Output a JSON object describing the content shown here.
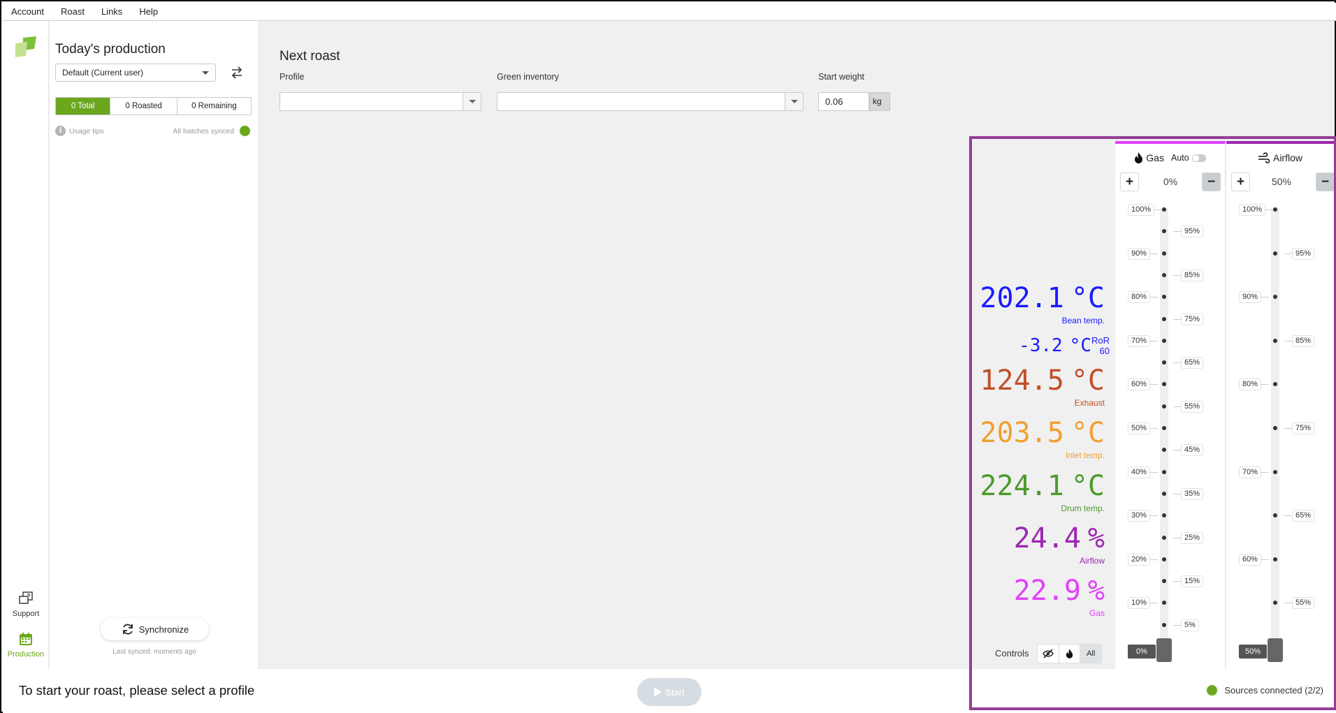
{
  "menu": [
    "Account",
    "Roast",
    "Links",
    "Help"
  ],
  "rail": {
    "support_label": "Support",
    "production_label": "Production"
  },
  "side": {
    "title": "Today's production",
    "user_select": "Default (Current user)",
    "tabs": [
      "0 Total",
      "0 Roasted",
      "0 Remaining"
    ],
    "usage_tips": "Usage tips",
    "batches_status": "All batches synced",
    "sync_button": "Synchronize",
    "last_synced": "Last synced: moments ago"
  },
  "main": {
    "title": "Next roast",
    "profile_label": "Profile",
    "profile_value": "",
    "inventory_label": "Green inventory",
    "inventory_value": "",
    "weight_label": "Start weight",
    "weight_value": "0.06",
    "weight_unit": "kg"
  },
  "footer": {
    "message": "To start your roast, please select a profile",
    "start_button": "Start",
    "sources": "Sources connected (2/2)"
  },
  "readings": [
    {
      "id": "bean",
      "value": "202.1",
      "unit": "°C",
      "label": "Bean temp.",
      "color": "#1a1aff"
    },
    {
      "id": "ror",
      "value": "-3.2",
      "unit": "°C",
      "label": "RoR 60",
      "color": "#1a1aff"
    },
    {
      "id": "exhaust",
      "value": "124.5",
      "unit": "°C",
      "label": "Exhaust",
      "color": "#c0502a"
    },
    {
      "id": "inlet",
      "value": "203.5",
      "unit": "°C",
      "label": "Inlet temp.",
      "color": "#f0a030"
    },
    {
      "id": "drum",
      "value": "224.1",
      "unit": "°C",
      "label": "Drum temp.",
      "color": "#4c9a2a"
    },
    {
      "id": "airflow",
      "value": "24.4",
      "unit": "%",
      "label": "Airflow",
      "color": "#9c27b0"
    },
    {
      "id": "gas",
      "value": "22.9",
      "unit": "%",
      "label": "Gas",
      "color": "#e040fb"
    }
  ],
  "ror_sub": [
    "RoR",
    "60"
  ],
  "controls": {
    "label": "Controls",
    "all_label": "All"
  },
  "gas": {
    "title": "Gas",
    "auto_label": "Auto",
    "value": "0%",
    "current": "0%",
    "level": 0,
    "ticks_left": [
      "100%",
      "90%",
      "80%",
      "70%",
      "60%",
      "50%",
      "40%",
      "30%",
      "20%",
      "10%"
    ],
    "ticks_right": [
      "95%",
      "85%",
      "75%",
      "65%",
      "55%",
      "45%",
      "35%",
      "25%",
      "15%",
      "5%"
    ]
  },
  "airflow": {
    "title": "Airflow",
    "value": "50%",
    "current": "50%",
    "level": 50,
    "ticks_left": [
      "100%",
      "90%",
      "80%",
      "70%",
      "60%"
    ],
    "ticks_right": [
      "95%",
      "85%",
      "75%",
      "65%",
      "55%"
    ]
  },
  "colors": {
    "accent": "#6aa71d",
    "highlight": "#943e94"
  },
  "icons": [
    "logo-icon",
    "support-icon",
    "calendar-icon",
    "swap-icon",
    "info-icon",
    "sync-icon",
    "flame-icon",
    "wind-icon",
    "eye-off-icon",
    "play-icon"
  ]
}
